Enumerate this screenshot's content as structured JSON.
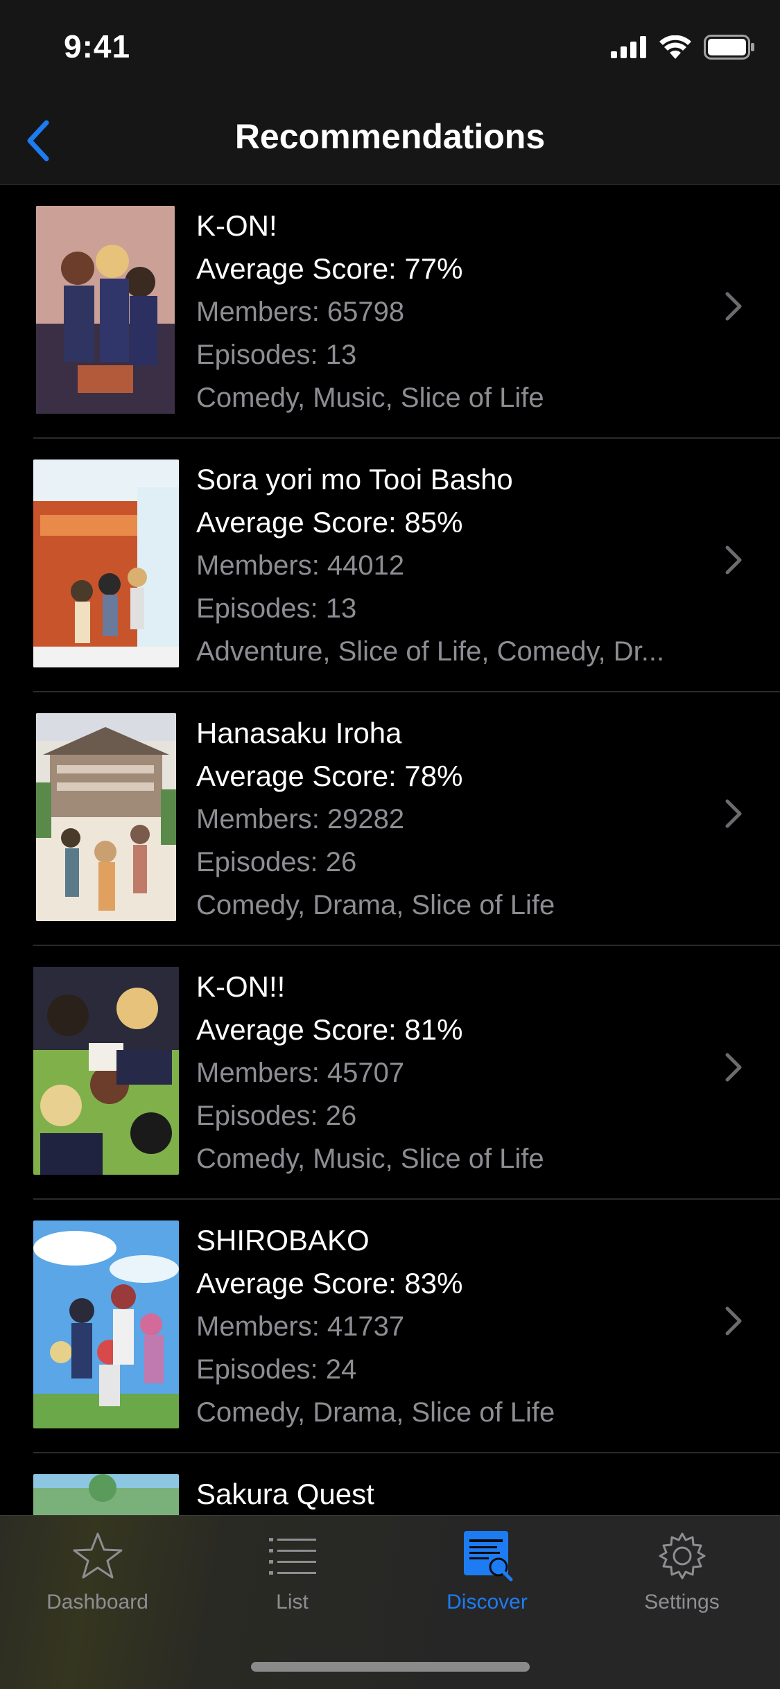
{
  "status_bar": {
    "time": "9:41"
  },
  "nav": {
    "title": "Recommendations"
  },
  "items": [
    {
      "title": "K-ON!",
      "score": "Average Score: 77%",
      "members": "Members: 65798",
      "episodes": "Episodes: 13",
      "genres": "Comedy, Music, Slice of Life"
    },
    {
      "title": "Sora yori mo Tooi Basho",
      "score": "Average Score: 85%",
      "members": "Members: 44012",
      "episodes": "Episodes: 13",
      "genres": "Adventure, Slice of Life, Comedy, Dr..."
    },
    {
      "title": "Hanasaku Iroha",
      "score": "Average Score: 78%",
      "members": "Members: 29282",
      "episodes": "Episodes: 26",
      "genres": "Comedy, Drama, Slice of Life"
    },
    {
      "title": "K-ON!!",
      "score": "Average Score: 81%",
      "members": "Members: 45707",
      "episodes": "Episodes: 26",
      "genres": "Comedy, Music, Slice of Life"
    },
    {
      "title": "SHIROBAKO",
      "score": "Average Score: 83%",
      "members": "Members: 41737",
      "episodes": "Episodes: 24",
      "genres": "Comedy, Drama, Slice of Life"
    },
    {
      "title": "Sakura Quest"
    }
  ],
  "tabs": [
    {
      "label": "Dashboard",
      "icon": "star-icon"
    },
    {
      "label": "List",
      "icon": "list-icon"
    },
    {
      "label": "Discover",
      "icon": "discover-icon",
      "active": true
    },
    {
      "label": "Settings",
      "icon": "gear-icon"
    }
  ],
  "colors": {
    "accent": "#1d7cf2",
    "secondary_text": "#8d8d93",
    "background": "#000000"
  }
}
